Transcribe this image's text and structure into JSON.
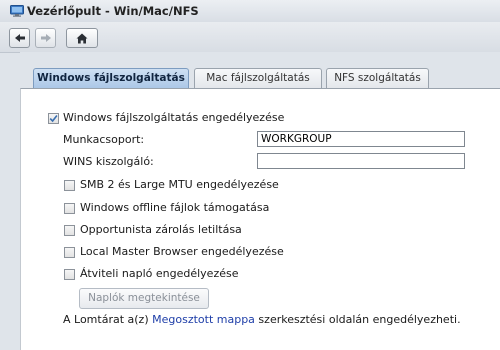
{
  "window": {
    "title": "Vezérlőpult - Win/Mac/NFS",
    "icon": "control-panel-icon"
  },
  "toolbar": {
    "back_icon": "arrow-left-icon",
    "forward_icon": "arrow-right-icon",
    "home_icon": "home-icon"
  },
  "tabs": [
    {
      "label": "Windows fájlszolgáltatás",
      "active": true
    },
    {
      "label": "Mac fájlszolgáltatás",
      "active": false
    },
    {
      "label": "NFS szolgáltatás",
      "active": false
    }
  ],
  "windows": {
    "enable_label": "Windows fájlszolgáltatás engedélyezése",
    "enable_checked": true,
    "workgroup_label": "Munkacsoport:",
    "workgroup_value": "WORKGROUP",
    "wins_label": "WINS kiszolgáló:",
    "wins_value": "",
    "options": [
      {
        "label": "SMB 2 és Large MTU engedélyezése",
        "checked": false
      },
      {
        "label": "Windows offline fájlok támogatása",
        "checked": false
      },
      {
        "label": "Opportunista zárolás letiltása",
        "checked": false
      },
      {
        "label": "Local Master Browser engedélyezése",
        "checked": false
      },
      {
        "label": "Átviteli napló engedélyezése",
        "checked": false
      }
    ],
    "logs_button": "Naplók megtekintése",
    "note_before": "A Lomtárat a(z) ",
    "note_link": "Megosztott mappa",
    "note_after": " szerkesztési oldalán engedélyezheti."
  },
  "colors": {
    "accent_tab": "#a9c6e6",
    "link": "#1e3ea8",
    "check": "#3a6fb0"
  }
}
